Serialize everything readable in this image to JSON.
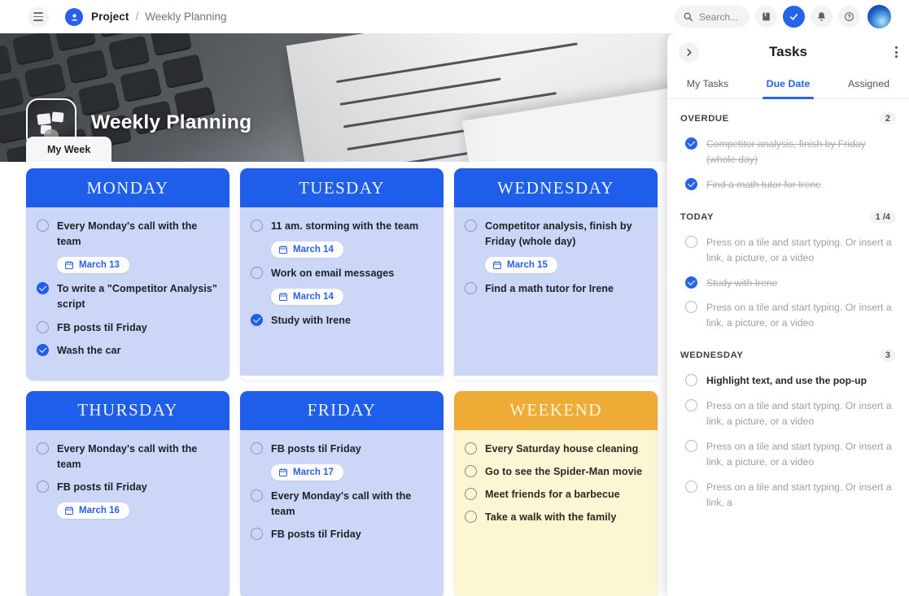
{
  "topbar": {
    "menu_icon": "hamburger-icon",
    "project_logo_icon": "project-logo-icon",
    "breadcrumb_root": "Project",
    "breadcrumb_separator": "/",
    "breadcrumb_current": "Weekly Planning",
    "search_placeholder": "Search...",
    "icons": [
      "search-icon",
      "archive-icon",
      "check-circle-icon",
      "bell-icon",
      "help-icon",
      "avatar"
    ]
  },
  "hero": {
    "title": "Weekly Planning",
    "badge_icon": "sticky-notes-icon",
    "tab_label": "My Week"
  },
  "board": {
    "cards": [
      {
        "day": "MONDAY",
        "theme": "blue",
        "items": [
          {
            "text": "Every Monday's call with the team",
            "done": false,
            "date": "March 13"
          },
          {
            "text": "To write a \"Competitor Analysis\" script",
            "done": true,
            "date": null
          },
          {
            "text": "FB posts til Friday",
            "done": false,
            "date": null
          },
          {
            "text": "Wash the car",
            "done": true,
            "date": null
          }
        ]
      },
      {
        "day": "TUESDAY",
        "theme": "blue",
        "items": [
          {
            "text": "11 am. storming with the team",
            "done": false,
            "date": "March 14"
          },
          {
            "text": "Work on email messages",
            "done": false,
            "date": "March 14"
          },
          {
            "text": "Study with Irene",
            "done": true,
            "date": null
          }
        ]
      },
      {
        "day": "WEDNESDAY",
        "theme": "blue",
        "items": [
          {
            "text": "Competitor analysis, finish by Friday (whole day)",
            "done": false,
            "date": "March 15"
          },
          {
            "text": "Find a math tutor for Irene",
            "done": false,
            "date": null
          }
        ]
      },
      {
        "day": "THURSDAY",
        "theme": "blue",
        "items": [
          {
            "text": "Every Monday's call with the team",
            "done": false,
            "date": null
          },
          {
            "text": "FB posts til Friday",
            "done": false,
            "date": "March 16"
          }
        ]
      },
      {
        "day": "FRIDAY",
        "theme": "blue",
        "items": [
          {
            "text": "FB posts til Friday",
            "done": false,
            "date": "March 17"
          },
          {
            "text": "Every Monday's call with the team",
            "done": false,
            "date": null
          },
          {
            "text": "FB posts til Friday",
            "done": false,
            "date": null
          }
        ]
      },
      {
        "day": "WEEKEND",
        "theme": "amber",
        "items": [
          {
            "text": "Every Saturday house cleaning",
            "done": false,
            "date": null
          },
          {
            "text": "Go to see the Spider-Man movie",
            "done": false,
            "date": null
          },
          {
            "text": "Meet friends for a barbecue",
            "done": false,
            "date": null
          },
          {
            "text": "Take a walk with the family",
            "done": false,
            "date": null
          }
        ]
      }
    ]
  },
  "panel": {
    "title": "Tasks",
    "collapse_icon": "chevron-right-icon",
    "more_icon": "kebab-menu-icon",
    "tabs": [
      {
        "label": "My Tasks",
        "active": false
      },
      {
        "label": "Due Date",
        "active": true
      },
      {
        "label": "Assigned",
        "active": false
      }
    ],
    "sections": [
      {
        "title": "OVERDUE",
        "count": "2",
        "items": [
          {
            "text": "Competitor analysis, finish by Friday (whole day)",
            "done": true,
            "strong": false
          },
          {
            "text": "Find a math tutor for Irene",
            "done": true,
            "strong": false
          }
        ]
      },
      {
        "title": "TODAY",
        "count": "1 /4",
        "items": [
          {
            "text": "Press on a tile and start typing. Or insert a link, a picture, or a video",
            "done": false,
            "strong": false
          },
          {
            "text": "Study with Irene",
            "done": true,
            "strong": false
          },
          {
            "text": "Press on a tile and start typing. Or insert a link, a picture, or a video",
            "done": false,
            "strong": false
          }
        ]
      },
      {
        "title": "WEDNESDAY",
        "count": "3",
        "items": [
          {
            "text": "Highlight text, and use the pop-up",
            "done": false,
            "strong": true
          },
          {
            "text": "Press on a tile and start typing. Or insert a link, a picture, or a video",
            "done": false,
            "strong": false
          },
          {
            "text": "Press on a tile and start typing. Or insert a link, a picture, or a video",
            "done": false,
            "strong": false
          },
          {
            "text": "Press on a tile and start typing. Or insert a link, a",
            "done": false,
            "strong": false
          }
        ]
      }
    ]
  },
  "colors": {
    "accent": "#2563eb",
    "card_header_blue": "#1f5eeb",
    "card_body_blue": "#ccd7f7",
    "card_header_amber": "#eeab36",
    "card_body_amber": "#fbf7d4"
  }
}
